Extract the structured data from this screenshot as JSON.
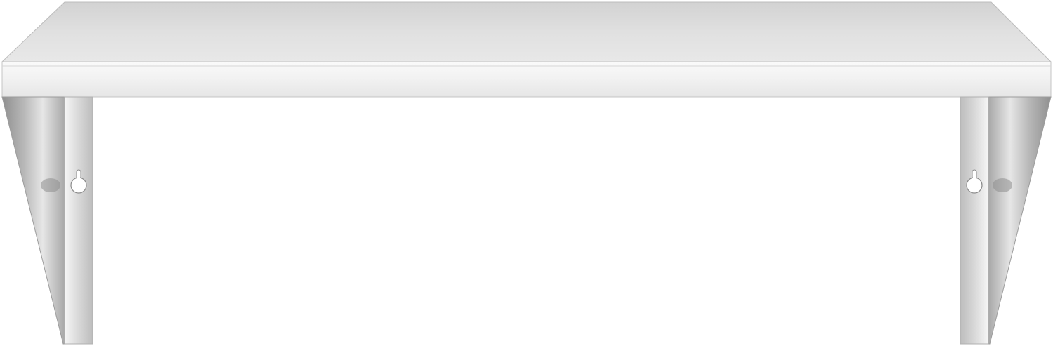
{
  "image": {
    "subject": "wall-mounted-stainless-steel-shelf",
    "background_color": "#ffffff",
    "colors": {
      "shelf_top": "#dcdcdc",
      "shelf_front_lip": "#f2f2f2",
      "bracket_dark": "#9a9a9a",
      "bracket_light": "#eeeeee",
      "keyhole": "#ffffff"
    },
    "parts": [
      "shelf-top-surface",
      "shelf-front-lip",
      "left-bracket",
      "right-bracket",
      "keyhole-slot"
    ]
  }
}
